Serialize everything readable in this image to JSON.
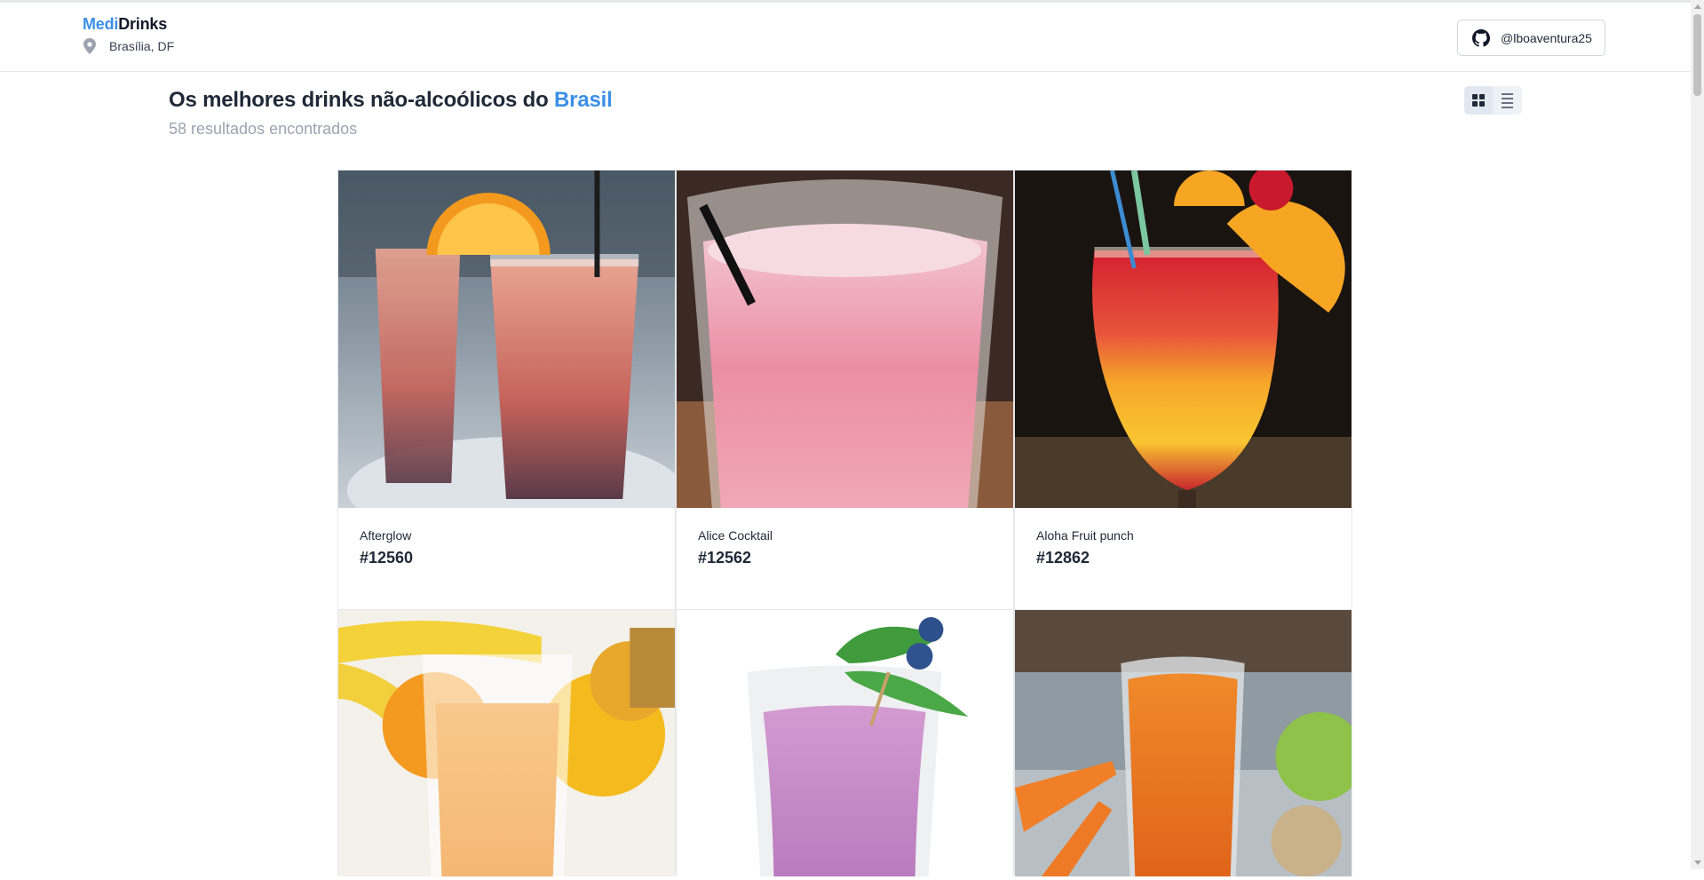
{
  "header": {
    "brand_part1": "Medi",
    "brand_part2": "Drinks",
    "location": "Brasília, DF",
    "github_handle": "@lboaventura25"
  },
  "main": {
    "title_prefix": "Os melhores drinks não-alcoólicos do ",
    "title_highlight": "Brasil",
    "results_count": "58 resultados encontrados",
    "view_modes": [
      "grid",
      "list"
    ],
    "active_view": "grid"
  },
  "drinks": [
    {
      "name": "Afterglow",
      "id": "#12560"
    },
    {
      "name": "Alice Cocktail",
      "id": "#12562"
    },
    {
      "name": "Aloha Fruit punch",
      "id": "#12862"
    },
    {
      "name": "",
      "id": ""
    },
    {
      "name": "",
      "id": ""
    },
    {
      "name": "",
      "id": ""
    }
  ],
  "icons": [
    "map-pin-icon",
    "github-icon",
    "grid-view-icon",
    "list-view-icon"
  ],
  "colors": {
    "accent": "#3b8fe6",
    "muted": "#9ca3af",
    "text": "#1f2937"
  }
}
